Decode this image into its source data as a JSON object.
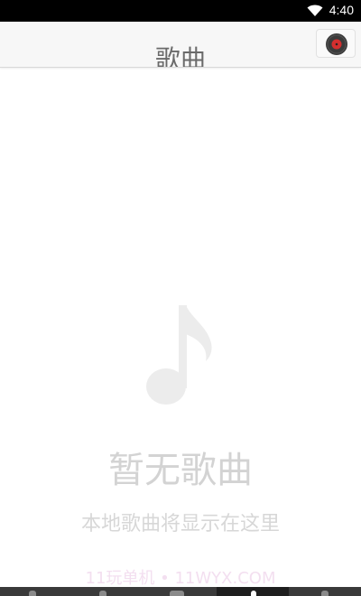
{
  "status": {
    "time": "4:40"
  },
  "header": {
    "title": "歌曲"
  },
  "empty": {
    "title": "暂无歌曲",
    "subtitle": "本地歌曲将显示在这里"
  },
  "watermark": "11玩单机 • 11WYX.COM",
  "icons": {
    "wifi": "wifi-icon",
    "disc": "vinyl-disc-icon",
    "music": "music-note-icon"
  },
  "colors": {
    "statusbar": "#000000",
    "header_bg": "#f7f7f7",
    "disc_red": "#d32f2f",
    "empty_text": "#d3d3d3",
    "bottombar": "#3a3a3a"
  }
}
